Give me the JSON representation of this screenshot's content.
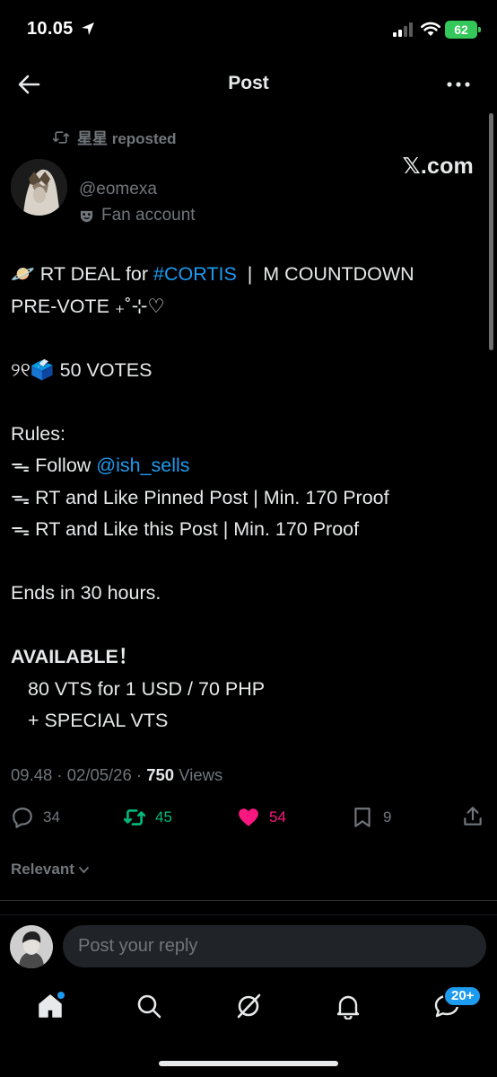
{
  "status_bar": {
    "time": "10.05",
    "battery": "62"
  },
  "header": {
    "title": "Post"
  },
  "repost": {
    "text": "星星 reposted"
  },
  "author": {
    "handle": "@eomexa",
    "badge": "Fan account",
    "source": "𝕏.com"
  },
  "post": {
    "line1_prefix": "🪐 RT DEAL for ",
    "line1_hashtag": "#CORTIS",
    "line1_suffix": "  |  M COUNTDOWN",
    "line2": "PRE-VOTE ₊˚⊹♡",
    "votes_line": "୨୧🗳️ 50 VOTES",
    "rules_heading": "Rules:",
    "rule1_prefix": "ᯓ Follow ",
    "rule1_mention": "@ish_sells",
    "rule2": "ᯓ RT and Like Pinned Post | Min. 170 Proof",
    "rule3": "ᯓ RT and Like this Post | Min. 170 Proof",
    "ends": "Ends in 30 hours.",
    "available": "AVAILABLE！",
    "offer1": "80 VTS for 1 USD / 70 PHP",
    "offer2": "+ SPECIAL VTS"
  },
  "meta": {
    "time": "09.48",
    "date": "02/05/26",
    "views_count": "750",
    "views_label": "Views"
  },
  "actions": {
    "replies": "34",
    "reposts": "45",
    "likes": "54",
    "bookmarks": "9"
  },
  "sort": {
    "label": "Relevant"
  },
  "reply": {
    "placeholder": "Post your reply"
  },
  "tabs": {
    "messages_badge": "20+"
  },
  "colors": {
    "link": "#1d9bf0",
    "repost": "#00ba7c",
    "like": "#f91880",
    "muted": "#71767b"
  }
}
